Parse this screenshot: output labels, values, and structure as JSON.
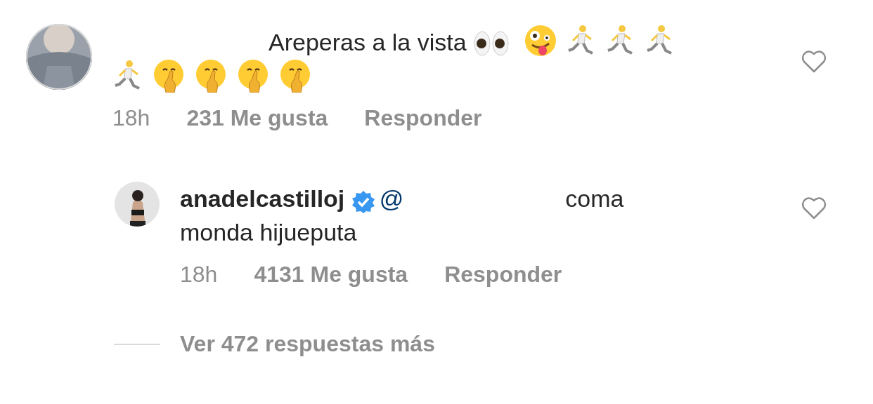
{
  "comments": [
    {
      "text": "Areperas a la vista",
      "emojis": [
        {
          "kind": "eyes"
        },
        {
          "kind": "zany"
        },
        {
          "kind": "runner"
        },
        {
          "kind": "runner"
        },
        {
          "kind": "runner"
        },
        {
          "kind": "runner"
        },
        {
          "kind": "shush"
        },
        {
          "kind": "shush"
        },
        {
          "kind": "shush"
        },
        {
          "kind": "shush"
        }
      ],
      "time": "18h",
      "likes": "231 Me gusta",
      "reply": "Responder",
      "liked": false
    }
  ],
  "reply": {
    "username": "anadelcastilloj",
    "verified": true,
    "mention": "@",
    "text_lines": [
      "coma",
      "monda hijueputa"
    ],
    "time": "18h",
    "likes": "4131 Me gusta",
    "reply": "Responder",
    "liked": false
  },
  "more_replies": "Ver 472 respuestas más"
}
